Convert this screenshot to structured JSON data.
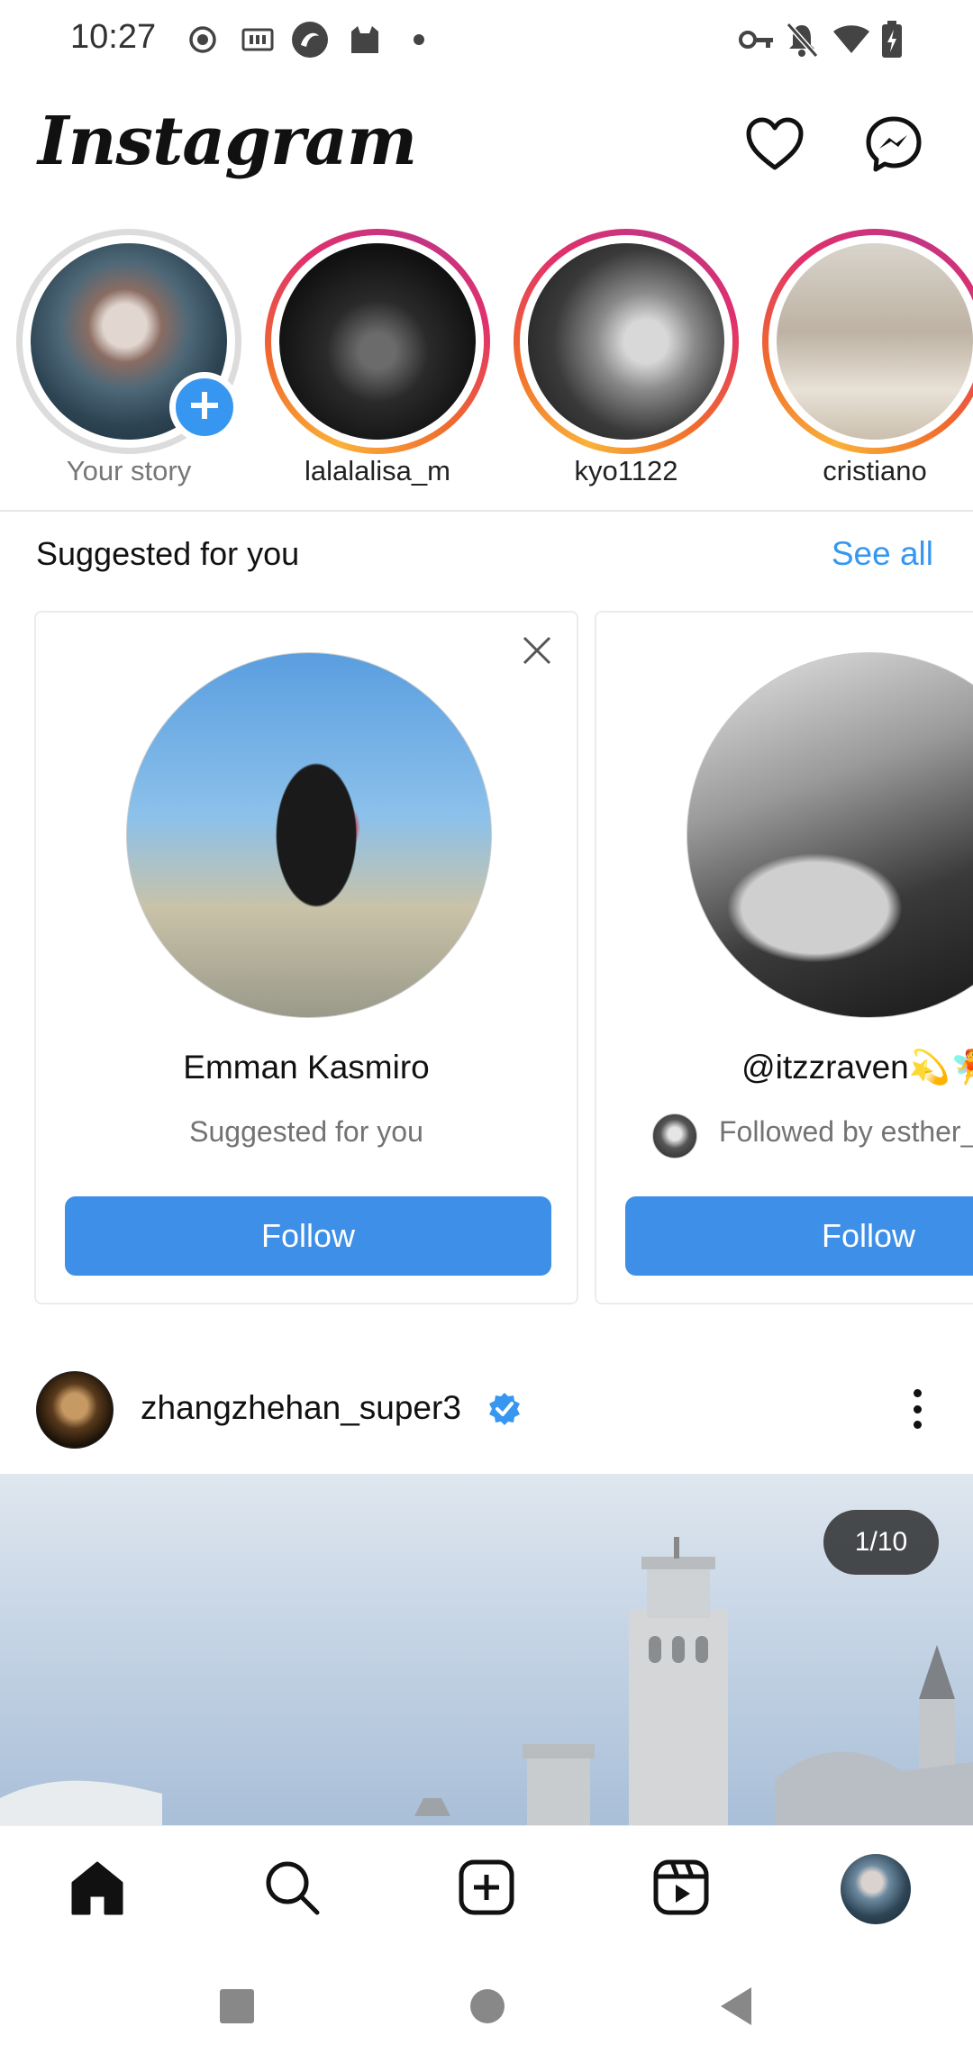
{
  "status_bar": {
    "time": "10:27",
    "left_icons": [
      "record-icon",
      "iqiyi-icon",
      "app-icon",
      "cat-icon",
      "dot-icon"
    ],
    "right_icons": [
      "vpn-key-icon",
      "notifications-off-icon",
      "wifi-icon",
      "battery-charging-icon"
    ]
  },
  "header": {
    "app_name": "Instagram",
    "actions": [
      "heart-icon",
      "messenger-icon"
    ]
  },
  "stories": [
    {
      "label": "Your story",
      "own": true
    },
    {
      "label": "lalalalisa_m",
      "own": false
    },
    {
      "label": "kyo1122",
      "own": false
    },
    {
      "label": "cristiano",
      "own": false
    }
  ],
  "suggested": {
    "title": "Suggested for you",
    "see_all": "See all",
    "cards": [
      {
        "name": "Emman Kasmiro",
        "subtitle": "Suggested for you",
        "follow_label": "Follow"
      },
      {
        "name": "@itzzraven💫🧚",
        "subtitle": "Followed by esther_",
        "follow_label": "Follow"
      }
    ]
  },
  "post": {
    "username": "zhangzhehan_super3",
    "verified": true,
    "carousel_counter": "1/10"
  },
  "bottom_nav": [
    "home-icon",
    "search-icon",
    "create-icon",
    "reels-icon",
    "profile-avatar"
  ],
  "system_nav": [
    "recents-button",
    "home-button",
    "back-button"
  ],
  "colors": {
    "accent_blue": "#3797f0",
    "follow_button": "#3d8fe8",
    "text": "#111111",
    "muted": "#737373"
  }
}
